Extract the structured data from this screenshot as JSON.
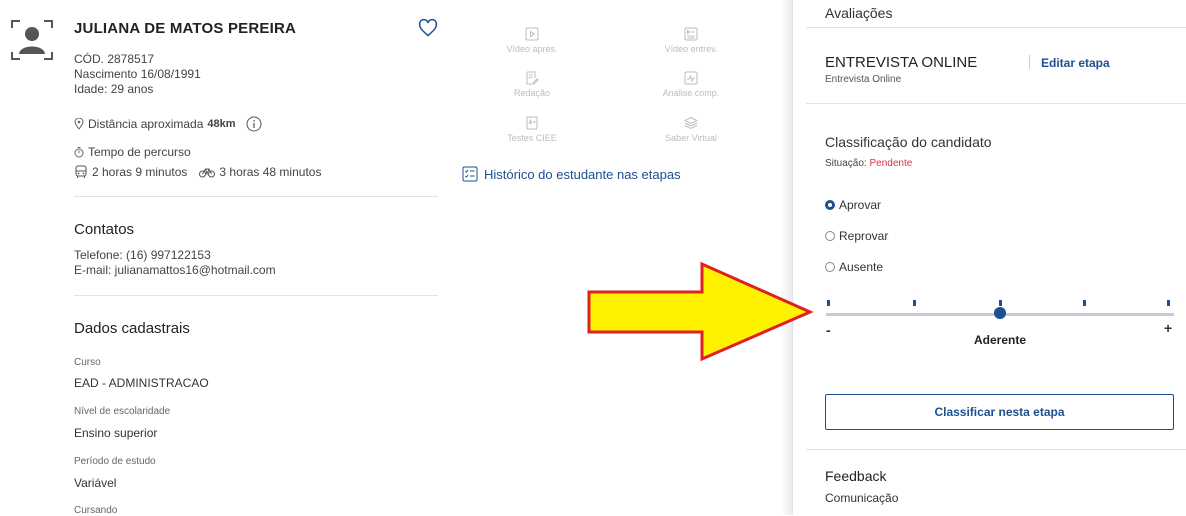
{
  "candidate": {
    "name": "JULIANA DE MATOS PEREIRA",
    "code": "CÓD. 2878517",
    "birth": "Nascimento 16/08/1991",
    "age": "Idade: 29 anos",
    "distance_label": "Distância aproximada",
    "distance_value": "48km",
    "travel_label": "Tempo de percurso",
    "travel_bus": "2 horas 9 minutos",
    "travel_bike": "3 horas 48 minutos"
  },
  "contacts": {
    "title": "Contatos",
    "phone": "Telefone: (16) 997122153",
    "email": "E-mail: julianamattos16@hotmail.com"
  },
  "registration": {
    "title": "Dados cadastrais",
    "fields": [
      {
        "label": "Curso",
        "value": "EAD - ADMINISTRACAO"
      },
      {
        "label": "Nível de escolaridade",
        "value": "Ensino superior"
      },
      {
        "label": "Período de estudo",
        "value": "Variável"
      },
      {
        "label": "Cursando",
        "value": ""
      }
    ]
  },
  "media": [
    {
      "icon": "play-video-icon",
      "label": "Vídeo apres."
    },
    {
      "icon": "video-interview-icon",
      "label": "Vídeo entrev."
    },
    {
      "icon": "edit-document-icon",
      "label": "Redação"
    },
    {
      "icon": "chart-analysis-icon",
      "label": "Análise comp."
    },
    {
      "icon": "test-document-icon",
      "label": "Testes CIEE"
    },
    {
      "icon": "layers-icon",
      "label": "Saber Virtual"
    }
  ],
  "history_link": "Histórico do estudante nas etapas",
  "panel": {
    "header": "Avaliações",
    "stage_title": "ENTREVISTA ONLINE",
    "stage_sub": "Entrevista Online",
    "edit_label": "Editar etapa",
    "class_title": "Classificação do candidato",
    "status_label": "Situação:",
    "status_value": "Pendente",
    "status_color": "#d9363e",
    "options": [
      "Aprovar",
      "Reprovar",
      "Ausente"
    ],
    "selected_option": "Aprovar",
    "slider_min": "-",
    "slider_max": "+",
    "slider_value_label": "Aderente",
    "slider_level": 0.5,
    "classify_button": "Classificar nesta etapa",
    "feedback_title": "Feedback",
    "feedback_item": "Comunicação"
  },
  "accent_color": "#1d4f91",
  "arrow_fill": "#fff200",
  "arrow_stroke": "#e02020"
}
